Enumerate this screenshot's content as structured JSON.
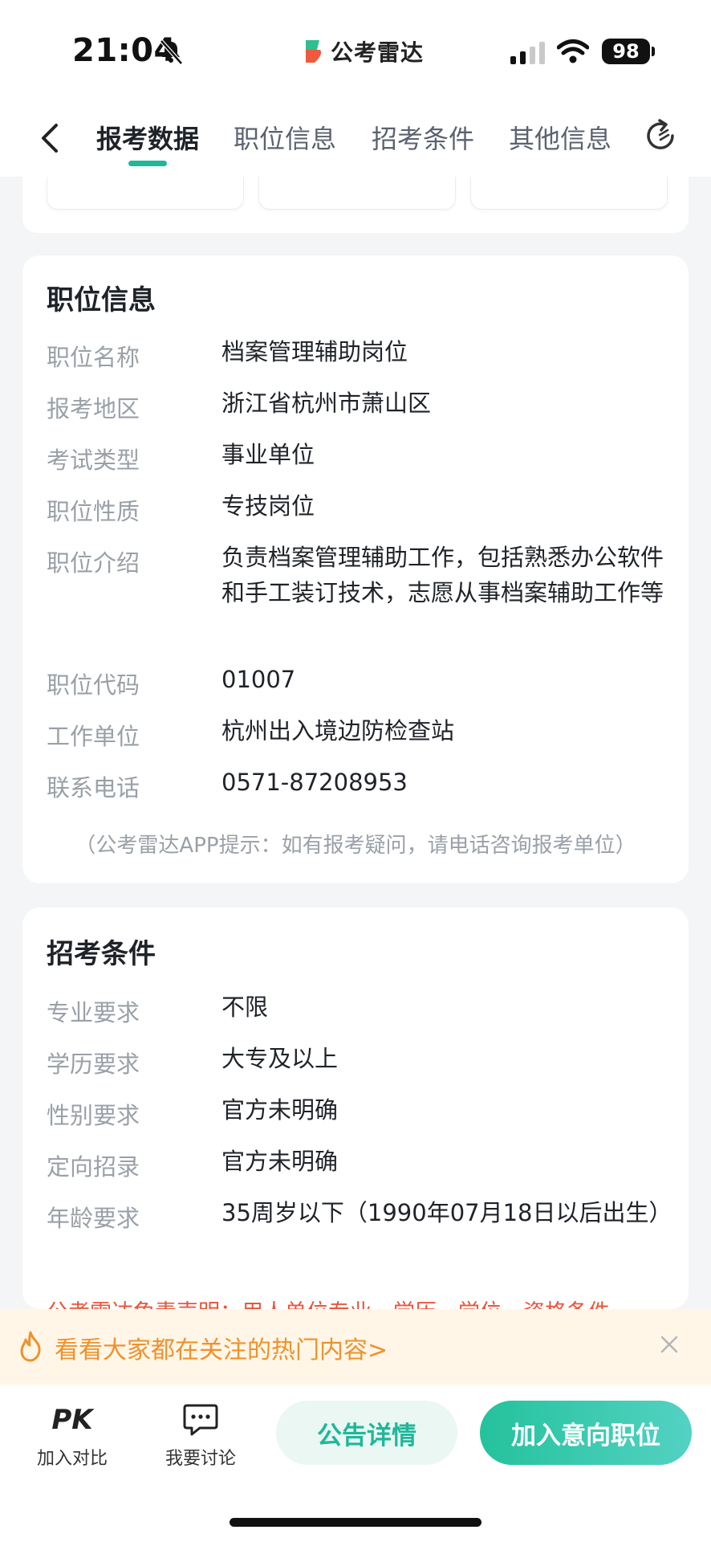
{
  "status_bar": {
    "time": "21:04",
    "battery": "98",
    "app_name": "公考雷达"
  },
  "nav": {
    "tabs": [
      {
        "label": "报考数据"
      },
      {
        "label": "职位信息"
      },
      {
        "label": "招考条件"
      },
      {
        "label": "其他信息"
      }
    ],
    "active_tab": 0
  },
  "position_info": {
    "title": "职位信息",
    "rows": [
      {
        "label": "职位名称",
        "value": "档案管理辅助岗位"
      },
      {
        "label": "报考地区",
        "value": "浙江省杭州市萧山区"
      },
      {
        "label": "考试类型",
        "value": "事业单位"
      },
      {
        "label": "职位性质",
        "value": "专技岗位"
      },
      {
        "label": "职位介绍",
        "value": "负责档案管理辅助工作，包括熟悉办公软件和手工装订技术，志愿从事档案辅助工作等"
      },
      {
        "label": "职位代码",
        "value": "01007"
      },
      {
        "label": "工作单位",
        "value": "杭州出入境边防检查站"
      },
      {
        "label": "联系电话",
        "value": "0571-87208953"
      }
    ],
    "hint": "（公考雷达APP提示：如有报考疑问，请电话咨询报考单位）"
  },
  "conditions": {
    "title": "招考条件",
    "rows": [
      {
        "label": "专业要求",
        "value": "不限"
      },
      {
        "label": "学历要求",
        "value": "大专及以上"
      },
      {
        "label": "性别要求",
        "value": "官方未明确"
      },
      {
        "label": "定向招录",
        "value": "官方未明确"
      },
      {
        "label": "年龄要求",
        "value": "35周岁以下（1990年07月18日以后出生）"
      }
    ],
    "disclaimer": "公考雷达免责声明：用人单位专业、学历、学位、资格条件"
  },
  "hot_banner": {
    "text": "看看大家都在关注的热门内容>"
  },
  "bottom_bar": {
    "pk_label": "加入对比",
    "pk_icon_text": "PK",
    "discuss_label": "我要讨论",
    "notice_button": "公告详情",
    "add_button": "加入意向职位"
  },
  "colors": {
    "accent": "#20b79a",
    "hot": "#f0912b",
    "disclaimer": "#e8563b"
  }
}
